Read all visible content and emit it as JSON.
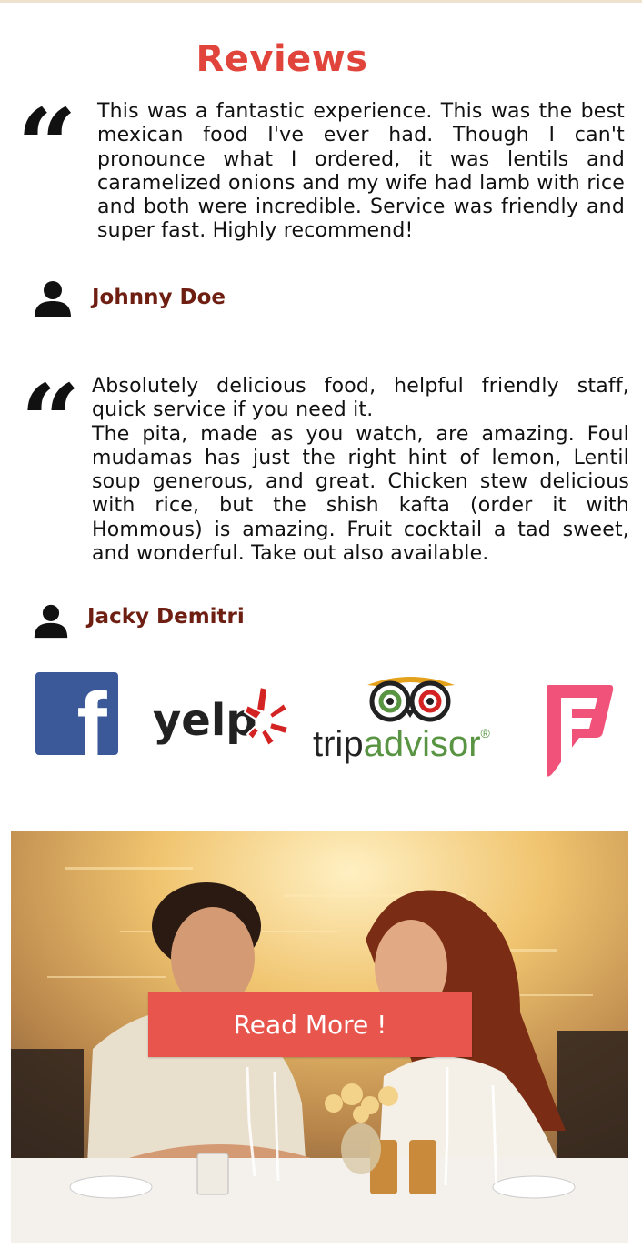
{
  "page": {
    "title": "Reviews"
  },
  "reviews": [
    {
      "paragraphs": [
        "This was a fantastic experience. This was the best mexican food I've ever had. Though I can't pronounce what I ordered, it was lentils and caramelized onions and my wife had lamb with rice and both were incredible. Service was friendly and super fast. Highly recommend!"
      ],
      "author": "Johnny Doe"
    },
    {
      "paragraphs": [
        "Absolutely delicious food, helpful friendly staff, quick service if you need it.",
        "The pita, made as you watch, are amazing. Foul mudamas has just the right hint of lemon, Lentil soup generous, and great. Chicken stew delicious with rice, but the shish kafta (order it with Hommous) is amazing. Fruit cocktail a tad sweet, and wonderful. Take out also available."
      ],
      "author": "Jacky Demitri"
    }
  ],
  "social": {
    "facebook_letter": "f",
    "yelp_text": "yelp",
    "tripadvisor_trip": "trip",
    "tripadvisor_advisor": "advisor",
    "tripadvisor_mark": "®",
    "foursquare_letter": "F",
    "colors": {
      "facebook": "#3b5998",
      "yelp": "#d32323",
      "tripadvisor_green": "#589442",
      "foursquare": "#f0527a"
    }
  },
  "hero": {
    "button_label": "Read More !"
  },
  "colors": {
    "title": "#e0443a",
    "author": "#6e1f12",
    "button": "#e8554d"
  }
}
